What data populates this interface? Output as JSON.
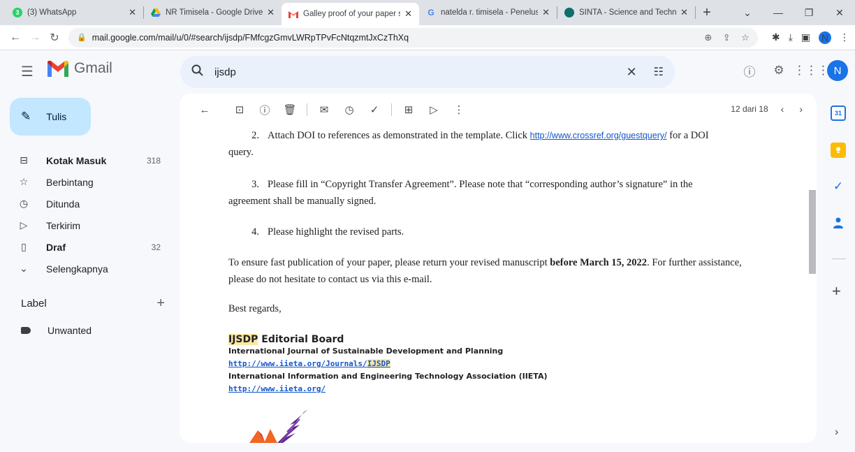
{
  "browser": {
    "tabs": [
      {
        "title": "(3) WhatsApp",
        "icon": "whatsapp-icon",
        "color": "#25d366",
        "badge": "3"
      },
      {
        "title": "NR Timisela - Google Drive",
        "icon": "google-drive-icon",
        "color": "#1fa463"
      },
      {
        "title": "Galley proof of your paper su",
        "icon": "gmail-icon",
        "color": "#ea4335",
        "active": true
      },
      {
        "title": "natelda r. timisela - Penelusu",
        "icon": "google-icon",
        "color": "#4285f4"
      },
      {
        "title": "SINTA - Science and Technolo",
        "icon": "sinta-icon",
        "color": "#0d6e6e"
      }
    ],
    "url": "mail.google.com/mail/u/0/#search/ijsdp/FMfcgzGmvLWRpTPvFcNtqzmtJxCzThXq",
    "profile_initial": "N"
  },
  "gmail": {
    "app_name": "Gmail",
    "search_query": "ijsdp",
    "avatar_initial": "N",
    "compose_label": "Tulis",
    "nav": [
      {
        "label": "Kotak Masuk",
        "count": "318",
        "icon": "inbox-icon",
        "bold": true
      },
      {
        "label": "Berbintang",
        "count": "",
        "icon": "star-icon"
      },
      {
        "label": "Ditunda",
        "count": "",
        "icon": "clock-icon"
      },
      {
        "label": "Terkirim",
        "count": "",
        "icon": "send-icon"
      },
      {
        "label": "Draf",
        "count": "32",
        "icon": "draft-icon",
        "bold": true
      },
      {
        "label": "Selengkapnya",
        "count": "",
        "icon": "chevron-down-icon"
      }
    ],
    "labels_heading": "Label",
    "labels": [
      {
        "label": "Unwanted"
      }
    ],
    "pager": "12 dari 18"
  },
  "email": {
    "item2_num": "2.",
    "item2_text_a": "Attach DOI to references as demonstrated in the template. Click ",
    "item2_link": "http://www.crossref.org/guestquery/",
    "item2_text_b": " for a DOI",
    "item2_cont": "query.",
    "item3_num": "3.",
    "item3_text": "Please fill in “Copyright Transfer Agreement”. Please note that “corresponding author’s signature” in the",
    "item3_cont": "agreement shall be manually signed.",
    "item4_num": "4.",
    "item4_text": "Please highlight the revised parts.",
    "para_a": "To ensure fast publication of your paper, please return your revised manuscript ",
    "para_bold": "before March 15, 2022",
    "para_b": ".  For further assistance,",
    "para_cont": "please do not hesitate to contact us via this e-mail.",
    "regards": "Best regards,",
    "sig_hl": "IJSDP",
    "sig_board": " Editorial Board",
    "sig_journal": "International Journal of Sustainable Development and Planning",
    "sig_link1_a": "http://www.iieta.org/Journals/",
    "sig_link1_hl": "IJSDP",
    "sig_assoc": "International Information and Engineering Technology Association (IIETA)",
    "sig_link2": "http://www.iieta.org/"
  },
  "side_panel": {
    "calendar_text": "31",
    "colors": {
      "calendar": "#1a73e8",
      "keep": "#fbbc04",
      "tasks": "#1a73e8",
      "contacts": "#1a73e8"
    }
  }
}
